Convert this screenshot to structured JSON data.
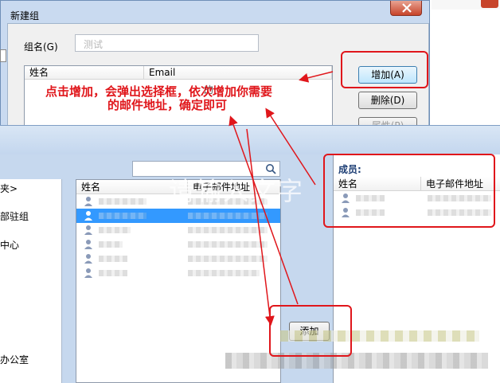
{
  "new_group_dialog": {
    "title": "新建组",
    "group_name_label": "组名(G)",
    "group_name_value": "测试",
    "list_headers": [
      "姓名",
      "Email"
    ],
    "partial_row_text": "的",
    "buttons": {
      "add": "增加(A)",
      "delete": "删除(D)",
      "properties": "属性(P)"
    }
  },
  "picker_window": {
    "left_pane_items": [
      "夹>",
      "部驻组",
      "中心",
      "办公室"
    ],
    "list_headers": [
      "姓名",
      "电子邮件地址"
    ],
    "members_label": "成员:",
    "members_headers": [
      "姓名",
      "电子邮件地址"
    ],
    "add_button": "添加"
  },
  "annotations": {
    "line1": "点击增加，会弹出选择框，依次增加你需要",
    "line2": "的邮件地址，确定即可"
  },
  "watermark": "请输入文字",
  "colors": {
    "annotation_red": "#e0161b",
    "selection_blue": "#3399ff"
  }
}
